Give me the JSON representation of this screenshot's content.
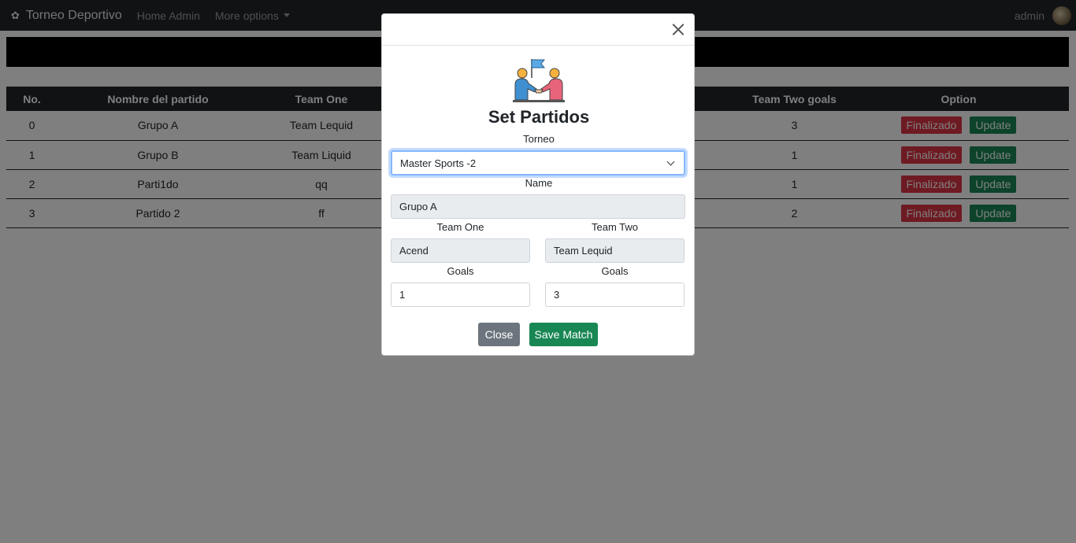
{
  "navbar": {
    "brand": "Torneo Deportivo",
    "brand_icon": "✿",
    "links": [
      "Home Admin",
      "More options"
    ],
    "user": "admin"
  },
  "table": {
    "headers": [
      "No.",
      "Nombre del partido",
      "Team One",
      "",
      "Team Two goals",
      "Option"
    ],
    "rows": [
      {
        "no": "0",
        "name": "Grupo A",
        "team_one": "Team Lequid",
        "team_two_goals": "3"
      },
      {
        "no": "1",
        "name": "Grupo B",
        "team_one": "Team Liquid",
        "team_two_goals": "1"
      },
      {
        "no": "2",
        "name": "Parti1do",
        "team_one": "qq",
        "team_two_goals": "1"
      },
      {
        "no": "3",
        "name": "Partido 2",
        "team_one": "ff",
        "team_two_goals": "2"
      }
    ],
    "finalizado_label": "Finalizado",
    "update_label": "Update"
  },
  "modal": {
    "title": "Set Partidos",
    "torneo_label": "Torneo",
    "torneo_value": "Master Sports -2",
    "name_label": "Name",
    "name_value": "Grupo A",
    "team_one_label": "Team One",
    "team_one_value": "Acend",
    "team_two_label": "Team Two",
    "team_two_value": "Team Lequid",
    "goals_label": "Goals",
    "goals_one_value": "1",
    "goals_two_value": "3",
    "close_label": "Close",
    "save_label": "Save Match"
  }
}
